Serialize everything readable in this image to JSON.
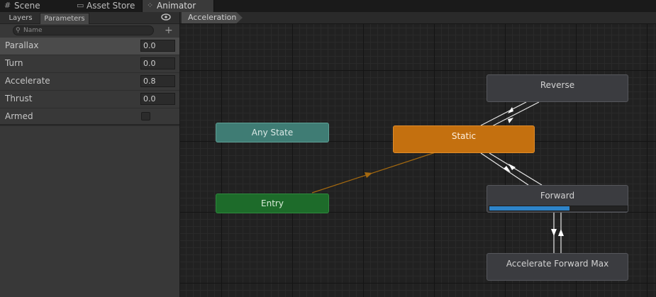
{
  "window_tabs": [
    {
      "label": "Scene",
      "icon": "grid-icon"
    },
    {
      "label": "Asset Store",
      "icon": "store-icon"
    },
    {
      "label": "Animator",
      "icon": "animator-icon"
    }
  ],
  "left_panel": {
    "tabs": [
      "Layers",
      "Parameters"
    ],
    "active_tab": "Parameters",
    "search": {
      "placeholder": "Name",
      "value": ""
    },
    "parameters": [
      {
        "name": "Parallax",
        "type": "float",
        "value": "0.0",
        "selected": true
      },
      {
        "name": "Turn",
        "type": "float",
        "value": "0.0"
      },
      {
        "name": "Accelerate",
        "type": "float",
        "value": "0.8"
      },
      {
        "name": "Thrust",
        "type": "float",
        "value": "0.0"
      },
      {
        "name": "Armed",
        "type": "bool",
        "checked": false
      }
    ]
  },
  "graph": {
    "breadcrumb": "Acceleration",
    "states": {
      "any_state": "Any State",
      "entry": "Entry",
      "static": "Static",
      "reverse": "Reverse",
      "forward": "Forward",
      "accelerate_forward_max": "Accelerate Forward Max"
    },
    "forward_progress": 0.58,
    "default_state": "Static"
  },
  "colors": {
    "any_state": "#3f7c74",
    "entry": "#1d6b2a",
    "default_state": "#c4700f",
    "state": "#3b3c40",
    "progress": "#2e84c9",
    "entry_transition": "#a5690f"
  }
}
